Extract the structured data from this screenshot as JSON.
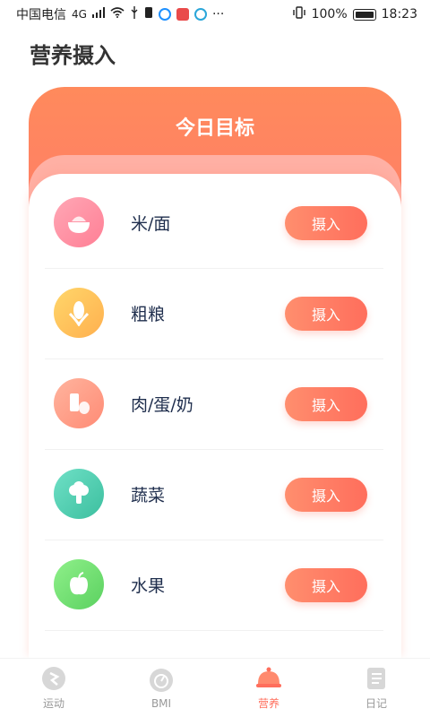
{
  "status_bar": {
    "carrier": "中国电信",
    "network": "4G",
    "battery_pct": "100%",
    "time": "18:23",
    "more": "···"
  },
  "page_title": "营养摄入",
  "card": {
    "title": "今日目标",
    "header_color": "#ff8a5c",
    "items": [
      {
        "label": "米/面",
        "button": "摄入",
        "icon": "rice-bowl-icon",
        "icon_color": "#ff8aa0"
      },
      {
        "label": "粗粮",
        "button": "摄入",
        "icon": "corn-icon",
        "icon_color": "#ffc45c"
      },
      {
        "label": "肉/蛋/奶",
        "button": "摄入",
        "icon": "meat-egg-milk-icon",
        "icon_color": "#ff9c84"
      },
      {
        "label": "蔬菜",
        "button": "摄入",
        "icon": "broccoli-icon",
        "icon_color": "#4fd0b0"
      },
      {
        "label": "水果",
        "button": "摄入",
        "icon": "apple-icon",
        "icon_color": "#77e07a"
      }
    ]
  },
  "bottom_nav": [
    {
      "label": "运动",
      "icon": "run-icon",
      "active": false
    },
    {
      "label": "BMI",
      "icon": "gauge-icon",
      "active": false
    },
    {
      "label": "营养",
      "icon": "cloche-icon",
      "active": true
    },
    {
      "label": "日记",
      "icon": "notebook-icon",
      "active": false
    }
  ],
  "accent_color": "#ff6e5c"
}
